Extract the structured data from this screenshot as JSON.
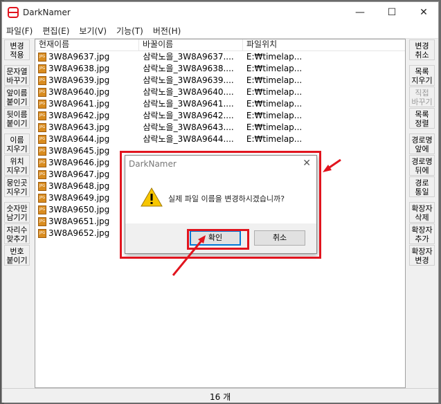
{
  "window": {
    "title": "DarkNamer",
    "minimize": "—",
    "maximize": "☐",
    "close": "✕"
  },
  "menu": [
    "파일(F)",
    "편집(E)",
    "보기(V)",
    "기능(T)",
    "버전(H)"
  ],
  "left_buttons": [
    {
      "label": "변경\n적용",
      "disabled": false
    },
    {
      "label": "문자열\n바꾸기",
      "disabled": false
    },
    {
      "label": "앞이름\n붙이기",
      "disabled": false
    },
    {
      "label": "뒷이름\n붙이기",
      "disabled": false
    },
    {
      "label": "이름\n지우기",
      "disabled": false
    },
    {
      "label": "위치\n지우기",
      "disabled": false
    },
    {
      "label": "뭉인곳\n지우기",
      "disabled": false
    },
    {
      "label": "숫자만\n남기기",
      "disabled": false
    },
    {
      "label": "자리수\n맞추기",
      "disabled": false
    },
    {
      "label": "번호\n붙이기",
      "disabled": false
    }
  ],
  "right_buttons": [
    {
      "label": "변경\n취소",
      "disabled": false
    },
    {
      "label": "목록\n지우기",
      "disabled": false
    },
    {
      "label": "직접\n바꾸기",
      "disabled": true
    },
    {
      "label": "목록\n정렬",
      "disabled": false
    },
    {
      "label": "경로명\n앞에",
      "disabled": false
    },
    {
      "label": "경로명\n뒤에",
      "disabled": false
    },
    {
      "label": "경로\n통일",
      "disabled": false
    },
    {
      "label": "확장자\n삭제",
      "disabled": false
    },
    {
      "label": "확장자\n추가",
      "disabled": false
    },
    {
      "label": "확장자\n변경",
      "disabled": false
    }
  ],
  "columns": [
    "현재이름",
    "바꿀이름",
    "파일위치"
  ],
  "files": [
    {
      "current": "3W8A9637.jpg",
      "new": "삼락노을_3W8A9637....",
      "location": "E:₩timelap..."
    },
    {
      "current": "3W8A9638.jpg",
      "new": "삼락노을_3W8A9638....",
      "location": "E:₩timelap..."
    },
    {
      "current": "3W8A9639.jpg",
      "new": "삼락노을_3W8A9639....",
      "location": "E:₩timelap..."
    },
    {
      "current": "3W8A9640.jpg",
      "new": "삼락노을_3W8A9640....",
      "location": "E:₩timelap..."
    },
    {
      "current": "3W8A9641.jpg",
      "new": "삼락노을_3W8A9641....",
      "location": "E:₩timelap..."
    },
    {
      "current": "3W8A9642.jpg",
      "new": "삼락노을_3W8A9642....",
      "location": "E:₩timelap..."
    },
    {
      "current": "3W8A9643.jpg",
      "new": "삼락노을_3W8A9643....",
      "location": "E:₩timelap..."
    },
    {
      "current": "3W8A9644.jpg",
      "new": "삼락노을_3W8A9644....",
      "location": "E:₩timelap..."
    },
    {
      "current": "3W8A9645.jpg",
      "new": "",
      "location": ""
    },
    {
      "current": "3W8A9646.jpg",
      "new": "",
      "location": ""
    },
    {
      "current": "3W8A9647.jpg",
      "new": "",
      "location": ""
    },
    {
      "current": "3W8A9648.jpg",
      "new": "",
      "location": ""
    },
    {
      "current": "3W8A9649.jpg",
      "new": "",
      "location": ""
    },
    {
      "current": "3W8A9650.jpg",
      "new": "",
      "location": ""
    },
    {
      "current": "3W8A9651.jpg",
      "new": "",
      "location": ""
    },
    {
      "current": "3W8A9652.jpg",
      "new": "",
      "location": ""
    }
  ],
  "file_icon_text": "JPG",
  "status": "16 개",
  "dialog": {
    "title": "DarkNamer",
    "message": "실제 파일 이름을 변경하시겠습니까?",
    "ok": "확인",
    "cancel": "취소"
  },
  "colors": {
    "annotation_red": "#e1141e",
    "focus_blue": "#0078d7"
  }
}
